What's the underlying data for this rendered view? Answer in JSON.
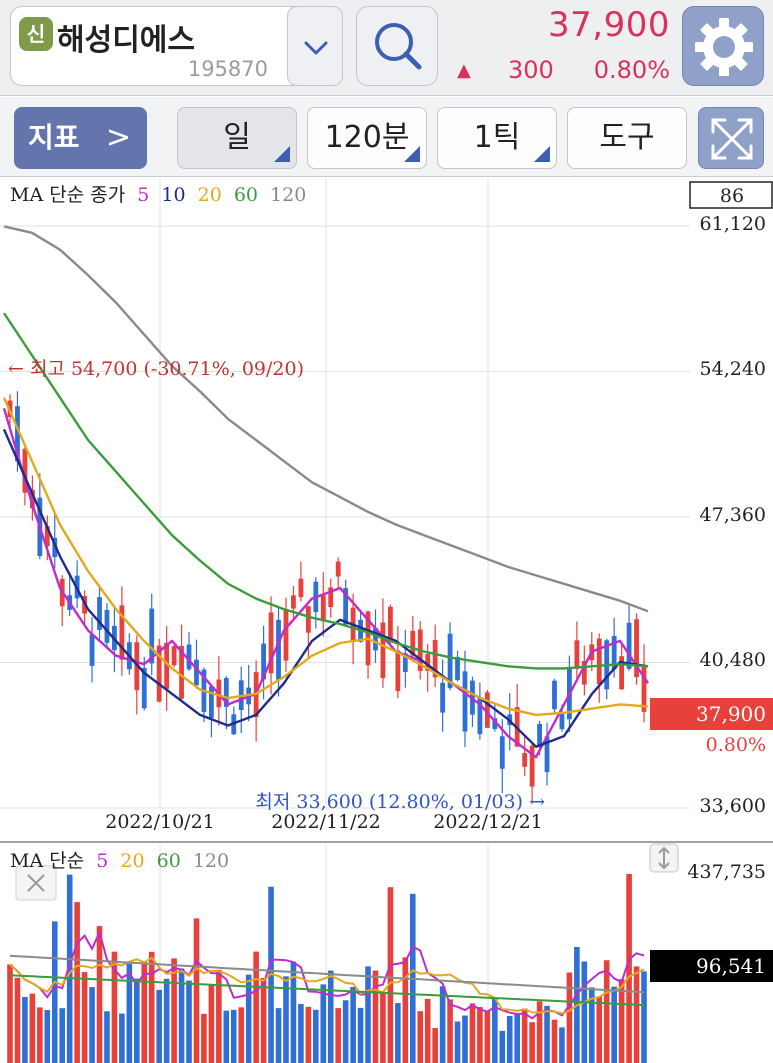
{
  "header": {
    "badge": "신",
    "stock_name": "해성디에스",
    "stock_code": "195870",
    "price": "37,900",
    "change_symbol": "▲",
    "change_value": "300",
    "change_percent": "0.80%"
  },
  "toolbar": {
    "indicator_label": "지표",
    "indicator_chevron": ">",
    "period_label": "일",
    "minute_label": "120분",
    "tick_label": "1틱",
    "tools_label": "도구"
  },
  "price_chart": {
    "legend": {
      "title": "MA 단순 종가",
      "ma5": "5",
      "ma10": "10",
      "ma20": "20",
      "ma60": "60",
      "ma120": "120"
    },
    "count_box": "86",
    "y_labels": [
      "61,120",
      "54,240",
      "47,360",
      "40,480",
      "33,600"
    ],
    "x_labels": [
      "2022/10/21",
      "2022/11/22",
      "2022/12/21"
    ],
    "high_note": "← 최고 54,700 (-30.71%, 09/20)",
    "low_note": "최저 33,600 (12.80%, 01/03) →",
    "current_price_tag": "37,900",
    "current_pct_tag": "0.80%",
    "ylim": [
      33600,
      61120
    ]
  },
  "volume_chart": {
    "legend": {
      "title": "MA 단순",
      "ma5": "5",
      "ma20": "20",
      "ma60": "60",
      "ma120": "120"
    },
    "y_top": "437,735",
    "current_volume": "96,541"
  },
  "colors": {
    "up": "#e8413c",
    "down": "#2f6fd6",
    "ma5": "#c02ccc",
    "ma10": "#1d2c8c",
    "ma20": "#e3a91c",
    "ma60": "#3b9c3b",
    "ma120": "#8a8a8a",
    "price_red": "#d9325c",
    "accent_blue": "#6475ad"
  },
  "chart_data": [
    {
      "type": "line",
      "title": "MA 단순 종가",
      "y_axis_ticks": [
        61120,
        54240,
        47360,
        40480,
        33600
      ],
      "ylim": [
        33600,
        61120
      ],
      "x_ticks": [
        "2022/10/21",
        "2022/11/22",
        "2022/12/21"
      ],
      "series": [
        {
          "name": "5",
          "approx_values": [
            52500,
            48000,
            44000,
            42000,
            40800,
            40400,
            41500,
            40000,
            38500,
            39000,
            42000,
            43500,
            44000,
            42500,
            41000,
            40500,
            39500,
            38500,
            37000,
            36000,
            38500,
            41000,
            41500,
            39500
          ]
        },
        {
          "name": "10",
          "approx_values": [
            51500,
            48500,
            45500,
            43000,
            41500,
            40000,
            39000,
            38000,
            37500,
            38000,
            39500,
            41500,
            42500,
            42000,
            41500,
            40500,
            39500,
            38800,
            37800,
            36500,
            37000,
            39000,
            40500,
            40300
          ]
        },
        {
          "name": "20",
          "approx_values": [
            53000,
            50000,
            47000,
            44800,
            43000,
            41500,
            40200,
            39200,
            38800,
            39000,
            39800,
            40800,
            41400,
            41600,
            41000,
            40300,
            39500,
            38800,
            38300,
            38000,
            38100,
            38300,
            38500,
            38400
          ]
        },
        {
          "name": "60",
          "approx_values": [
            57000,
            55000,
            53000,
            51000,
            49500,
            48000,
            46500,
            45300,
            44200,
            43500,
            43000,
            42600,
            42300,
            41900,
            41400,
            41000,
            40700,
            40500,
            40300,
            40200,
            40200,
            40300,
            40400,
            40300
          ]
        },
        {
          "name": "120",
          "approx_values": [
            61100,
            60800,
            60000,
            58800,
            57500,
            56000,
            54500,
            53300,
            52000,
            51000,
            50000,
            49000,
            48300,
            47600,
            47000,
            46500,
            46000,
            45500,
            45000,
            44600,
            44200,
            43800,
            43400,
            42900
          ]
        }
      ],
      "high": {
        "value": 54700,
        "date": "09/20",
        "pct": "-30.71%"
      },
      "low": {
        "value": 33600,
        "date": "01/03",
        "pct": "12.80%"
      },
      "last_close": 37900
    },
    {
      "type": "bar",
      "title": "MA 단순",
      "y_top": 437735,
      "last_volume": 96541
    }
  ]
}
